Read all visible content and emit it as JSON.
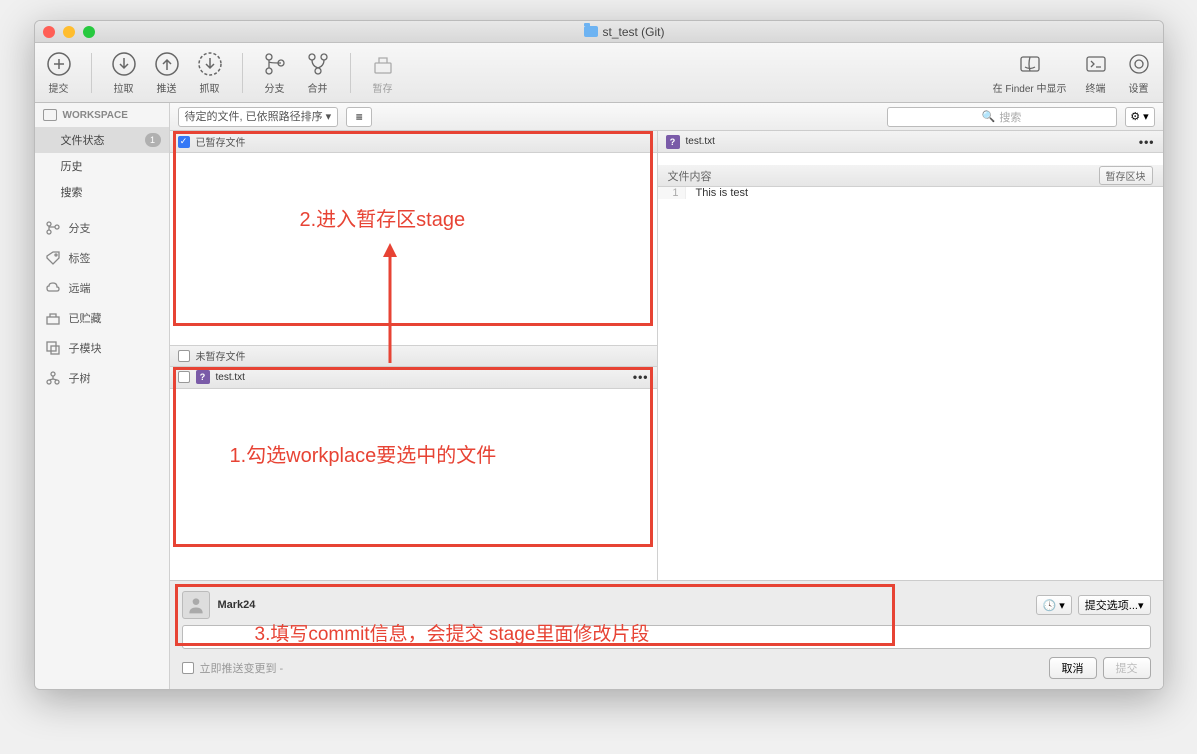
{
  "window": {
    "title": "st_test (Git)"
  },
  "toolbar": {
    "commit": "提交",
    "pull": "拉取",
    "push": "推送",
    "fetch": "抓取",
    "branch": "分支",
    "merge": "合并",
    "stash": "暂存",
    "showInFinder": "在 Finder 中显示",
    "terminal": "终端",
    "settings": "设置"
  },
  "sidebar": {
    "workspace": "WORKSPACE",
    "fileStatus": "文件状态",
    "badge": "1",
    "history": "历史",
    "search": "搜索",
    "branches": "分支",
    "tags": "标签",
    "remotes": "远端",
    "stashes": "已贮藏",
    "submodules": "子模块",
    "subtrees": "子树"
  },
  "subtoolbar": {
    "sort": "待定的文件, 已依照路径排序",
    "searchPlaceholder": "搜索"
  },
  "staged": {
    "label": "已暂存文件"
  },
  "unstaged": {
    "label": "未暂存文件",
    "file": "test.txt"
  },
  "diff": {
    "file": "test.txt",
    "contentLabel": "文件内容",
    "hunkBtn": "暂存区块",
    "lineNum": "1",
    "lineText": "This is test"
  },
  "commit": {
    "author": "Mark24",
    "optionsLabel": "提交选项...",
    "pushLabel": "立即推送变更到 -",
    "cancel": "取消",
    "submit": "提交"
  },
  "annotations": {
    "a1": "1.勾选workplace要选中的文件",
    "a2": "2.进入暂存区stage",
    "a3": "3.填写commit信息，会提交 stage里面修改片段"
  }
}
